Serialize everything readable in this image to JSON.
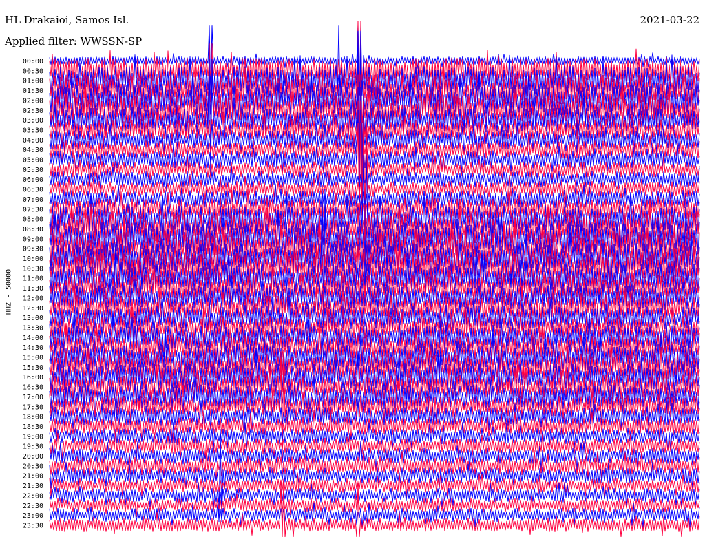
{
  "header": {
    "station": "HL Drakaioi, Samos Isl.",
    "filter": "Applied filter: WWSSN-SP",
    "date": "2021-03-22"
  },
  "channel_label": "HHZ - 50000",
  "colors": {
    "trace_a": "#0000ff",
    "trace_b": "#ff0040",
    "text": "#000000",
    "background": "#ffffff"
  },
  "chart_data": {
    "type": "line",
    "title": "HL Drakaioi, Samos Isl.",
    "subtitle": "Applied filter: WWSSN-SP",
    "ylabel": "HHZ - 50000",
    "grid": false,
    "series": [
      {
        "color": "#0000ff"
      },
      {
        "color": "#ff0040"
      }
    ],
    "rows": [
      {
        "time": "00:00",
        "amplitude": 0.25
      },
      {
        "time": "00:30",
        "amplitude": 0.7
      },
      {
        "time": "01:00",
        "amplitude": 0.8
      },
      {
        "time": "01:30",
        "amplitude": 0.85
      },
      {
        "time": "02:00",
        "amplitude": 0.85
      },
      {
        "time": "02:30",
        "amplitude": 0.8
      },
      {
        "time": "03:00",
        "amplitude": 0.7
      },
      {
        "time": "03:30",
        "amplitude": 0.6
      },
      {
        "time": "04:00",
        "amplitude": 0.55
      },
      {
        "time": "04:30",
        "amplitude": 0.5
      },
      {
        "time": "05:00",
        "amplitude": 0.5
      },
      {
        "time": "05:30",
        "amplitude": 0.45
      },
      {
        "time": "06:00",
        "amplitude": 0.45
      },
      {
        "time": "06:30",
        "amplitude": 0.45
      },
      {
        "time": "07:00",
        "amplitude": 0.5
      },
      {
        "time": "07:30",
        "amplitude": 0.6
      },
      {
        "time": "08:00",
        "amplitude": 0.75
      },
      {
        "time": "08:30",
        "amplitude": 0.85
      },
      {
        "time": "09:00",
        "amplitude": 0.9
      },
      {
        "time": "09:30",
        "amplitude": 0.9
      },
      {
        "time": "10:00",
        "amplitude": 0.85
      },
      {
        "time": "10:30",
        "amplitude": 0.85
      },
      {
        "time": "11:00",
        "amplitude": 0.8
      },
      {
        "time": "11:30",
        "amplitude": 0.75
      },
      {
        "time": "12:00",
        "amplitude": 0.7
      },
      {
        "time": "12:30",
        "amplitude": 0.7
      },
      {
        "time": "13:00",
        "amplitude": 0.65
      },
      {
        "time": "13:30",
        "amplitude": 0.65
      },
      {
        "time": "14:00",
        "amplitude": 0.7
      },
      {
        "time": "14:30",
        "amplitude": 0.7
      },
      {
        "time": "15:00",
        "amplitude": 0.75
      },
      {
        "time": "15:30",
        "amplitude": 0.75
      },
      {
        "time": "16:00",
        "amplitude": 0.75
      },
      {
        "time": "16:30",
        "amplitude": 0.7
      },
      {
        "time": "17:00",
        "amplitude": 0.7
      },
      {
        "time": "17:30",
        "amplitude": 0.6
      },
      {
        "time": "18:00",
        "amplitude": 0.55
      },
      {
        "time": "18:30",
        "amplitude": 0.5
      },
      {
        "time": "19:00",
        "amplitude": 0.45
      },
      {
        "time": "19:30",
        "amplitude": 0.45
      },
      {
        "time": "20:00",
        "amplitude": 0.45
      },
      {
        "time": "20:30",
        "amplitude": 0.5
      },
      {
        "time": "21:00",
        "amplitude": 0.45
      },
      {
        "time": "21:30",
        "amplitude": 0.4
      },
      {
        "time": "22:00",
        "amplitude": 0.4
      },
      {
        "time": "22:30",
        "amplitude": 0.4
      },
      {
        "time": "23:00",
        "amplitude": 0.4
      },
      {
        "time": "23:30",
        "amplitude": 0.4
      }
    ]
  }
}
